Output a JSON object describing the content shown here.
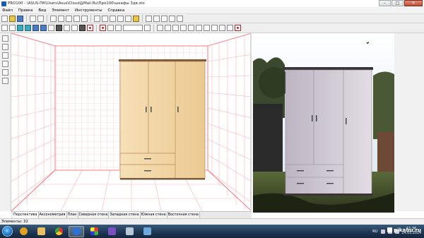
{
  "window": {
    "title": "PRO100 - \\ASUS-ПК\\Users\\Asus\\Cloud@Mail.Ru\\Про100\\шкафы 3дв.sto"
  },
  "menu": [
    "Файл",
    "Правка",
    "Вид",
    "Элемент",
    "Инструменты",
    "Справка"
  ],
  "view_tabs": [
    "Перспектива",
    "Аксонометрия",
    "План",
    "Северная стена",
    "Западная стена",
    "Южная стена",
    "Восточная стена"
  ],
  "status": {
    "elements_label": "Элементы: 32"
  },
  "taskbar": {
    "language": "RU",
    "time": "11:36",
    "date": "24.05.2014"
  },
  "watermark": "pikabu.ru",
  "colors": {
    "grid_line": "#ff7f8a",
    "wardrobe_wood": "#f1d6a3",
    "taskbar": "#1d3550"
  }
}
